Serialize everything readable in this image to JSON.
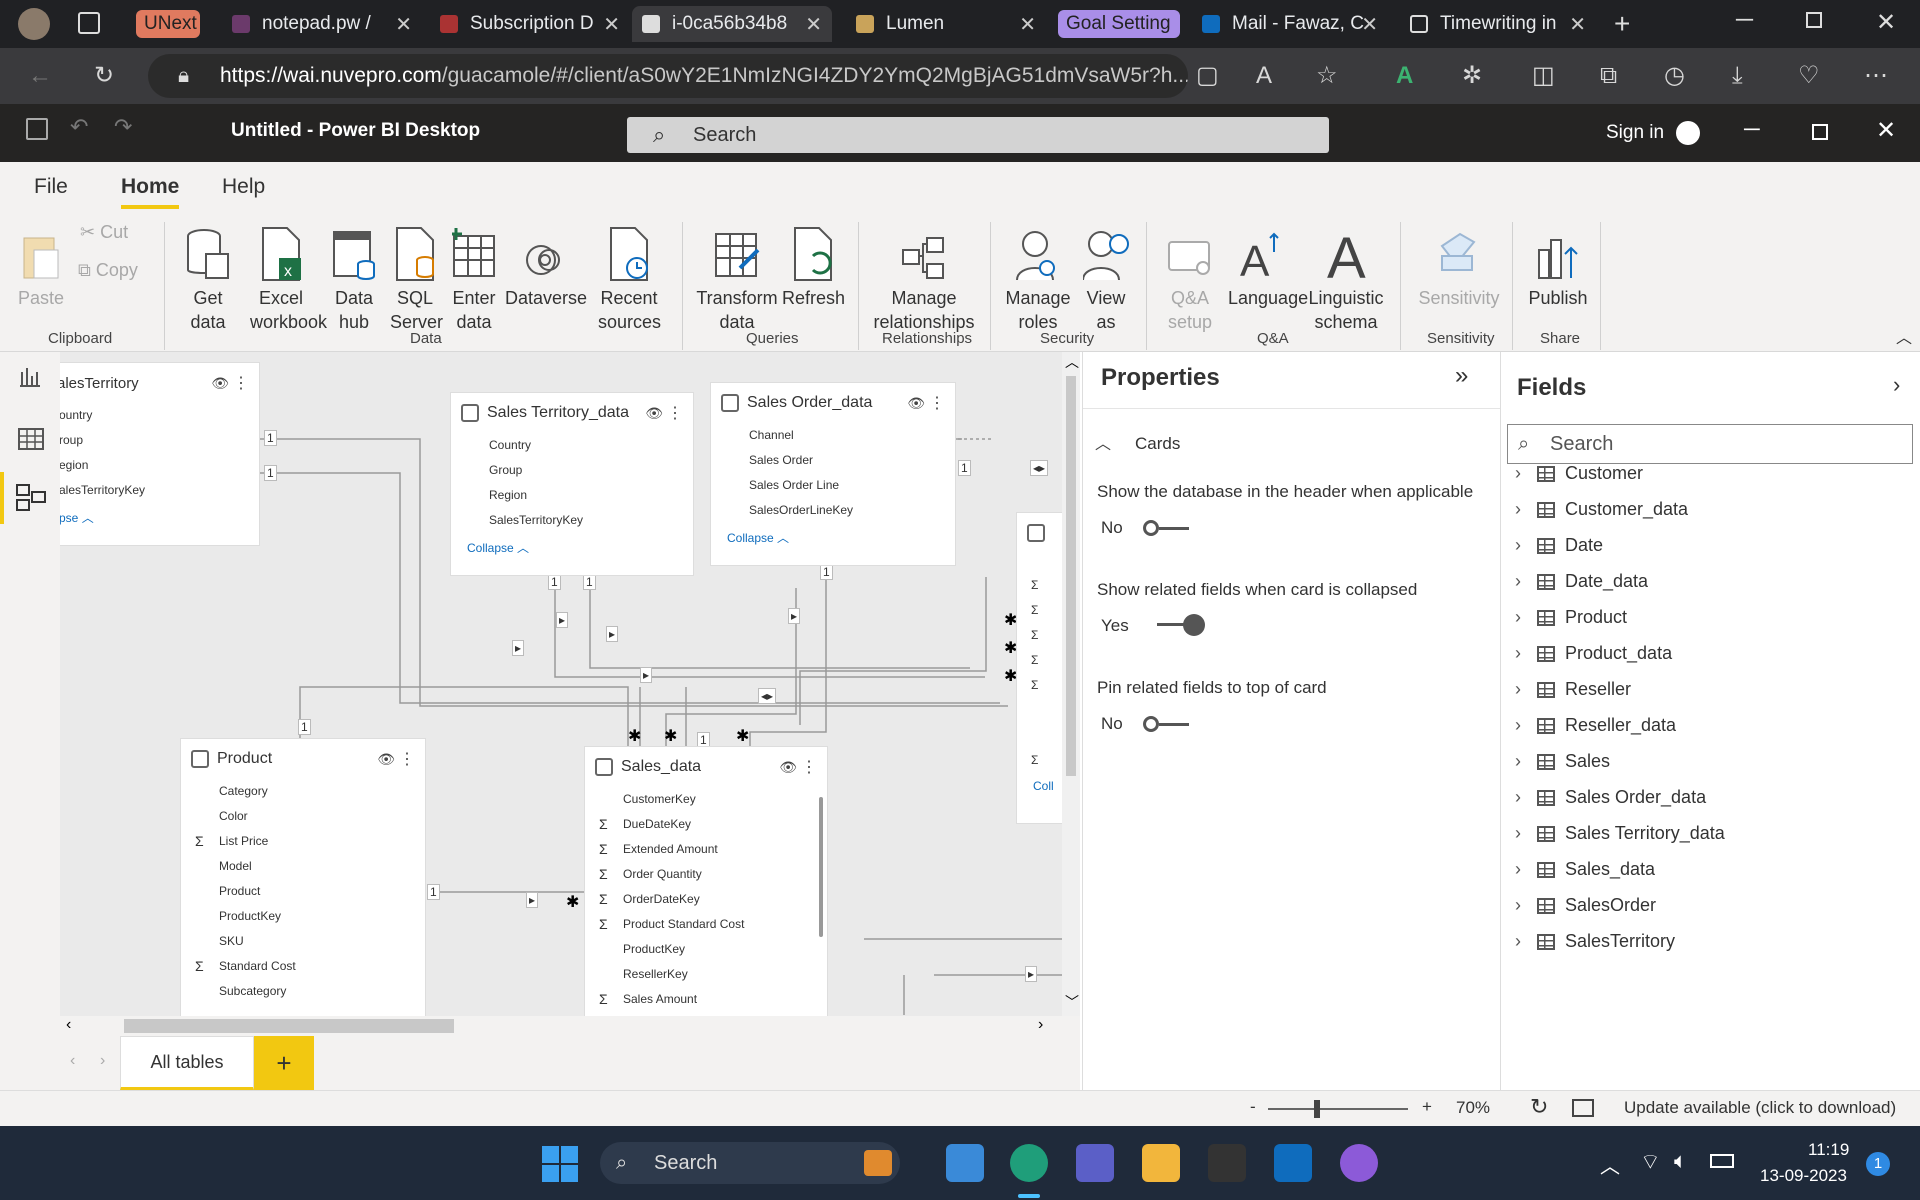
{
  "browser": {
    "tabs": [
      {
        "label": "UNext",
        "kind": "group"
      },
      {
        "label": "notepad.pw /",
        "kind": "tab"
      },
      {
        "label": "Subscription D",
        "kind": "tab"
      },
      {
        "label": "i-0ca56b34b8",
        "kind": "tab",
        "active": true
      },
      {
        "label": "Lumen",
        "kind": "tab"
      },
      {
        "label": "Goal Setting",
        "kind": "group"
      },
      {
        "label": "Mail - Fawaz, C",
        "kind": "tab"
      },
      {
        "label": "Timewriting in",
        "kind": "tab"
      }
    ],
    "url_host": "https://wai.nuvepro.com",
    "url_path": "/guacamole/#/client/aS0wY2E1NmIzNGI4ZDY2YmQ2MgBjAG51dmVsaW5r?h..."
  },
  "pbi": {
    "title": "Untitled - Power BI Desktop",
    "search_placeholder": "Search",
    "sign_in": "Sign in"
  },
  "menu": {
    "file": "File",
    "home": "Home",
    "help": "Help"
  },
  "ribbon": {
    "paste": "Paste",
    "cut": "Cut",
    "copy": "Copy",
    "get_data": "Get data",
    "excel": "Excel workbook",
    "data_hub": "Data hub",
    "sql": "SQL Server",
    "enter_data": "Enter data",
    "dataverse": "Dataverse",
    "recent": "Recent sources",
    "transform": "Transform data",
    "refresh": "Refresh",
    "manage_rel": "Manage relationships",
    "manage_roles": "Manage roles",
    "view_as": "View as",
    "qa_setup": "Q&A setup",
    "language": "Language",
    "linguistic": "Linguistic schema",
    "sensitivity": "Sensitivity",
    "publish": "Publish",
    "groups": {
      "clipboard": "Clipboard",
      "data": "Data",
      "queries": "Queries",
      "relationships": "Relationships",
      "security": "Security",
      "qa": "Q&A",
      "sensitivity": "Sensitivity",
      "share": "Share"
    }
  },
  "cards": {
    "sales_territory": {
      "title": "alesTerritory",
      "fields": [
        "ountry",
        "roup",
        "egion",
        "alesTerritoryKey"
      ],
      "collapse": "pse"
    },
    "sales_territory_data": {
      "title": "Sales Territory_data",
      "fields": [
        "Country",
        "Group",
        "Region",
        "SalesTerritoryKey"
      ],
      "collapse": "Collapse"
    },
    "sales_order_data": {
      "title": "Sales Order_data",
      "fields": [
        "Channel",
        "Sales Order",
        "Sales Order Line",
        "SalesOrderLineKey"
      ],
      "collapse": "Collapse"
    },
    "product": {
      "title": "Product",
      "fields": [
        {
          "n": "Category",
          "s": ""
        },
        {
          "n": "Color",
          "s": ""
        },
        {
          "n": "List Price",
          "s": "Σ"
        },
        {
          "n": "Model",
          "s": ""
        },
        {
          "n": "Product",
          "s": ""
        },
        {
          "n": "ProductKey",
          "s": ""
        },
        {
          "n": "SKU",
          "s": ""
        },
        {
          "n": "Standard Cost",
          "s": "Σ"
        },
        {
          "n": "Subcategory",
          "s": ""
        }
      ]
    },
    "sales_data": {
      "title": "Sales_data",
      "fields": [
        {
          "n": "CustomerKey",
          "s": ""
        },
        {
          "n": "DueDateKey",
          "s": "Σ"
        },
        {
          "n": "Extended Amount",
          "s": "Σ"
        },
        {
          "n": "Order Quantity",
          "s": "Σ"
        },
        {
          "n": "OrderDateKey",
          "s": "Σ"
        },
        {
          "n": "Product Standard Cost",
          "s": "Σ"
        },
        {
          "n": "ProductKey",
          "s": ""
        },
        {
          "n": "ResellerKey",
          "s": ""
        },
        {
          "n": "Sales Amount",
          "s": "Σ"
        }
      ]
    },
    "right_partial_collapse": "Coll"
  },
  "properties": {
    "title": "Properties",
    "section": "Cards",
    "opt1_label": "Show the database in the header when applicable",
    "opt1_value": "No",
    "opt2_label": "Show related fields when card is collapsed",
    "opt2_value": "Yes",
    "opt3_label": "Pin related fields to top of card",
    "opt3_value": "No"
  },
  "fields": {
    "title": "Fields",
    "search_placeholder": "Search",
    "items": [
      "Customer",
      "Customer_data",
      "Date",
      "Date_data",
      "Product",
      "Product_data",
      "Reseller",
      "Reseller_data",
      "Sales",
      "Sales Order_data",
      "Sales Territory_data",
      "Sales_data",
      "SalesOrder",
      "SalesTerritory"
    ]
  },
  "page_tabs": {
    "all_tables": "All tables",
    "add": "+"
  },
  "status": {
    "zoom": "70%",
    "update": "Update available (click to download)"
  },
  "taskbar": {
    "search": "Search",
    "time": "11:19",
    "date": "13-09-2023",
    "badge": "1"
  }
}
